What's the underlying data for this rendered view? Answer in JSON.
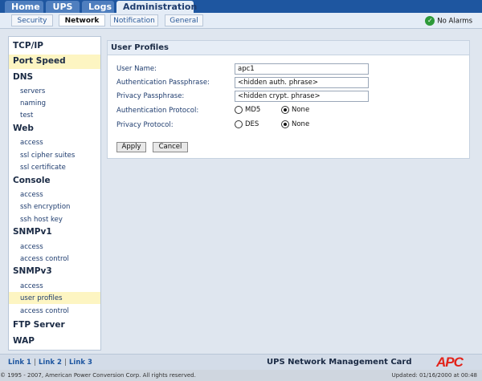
{
  "top_tabs": [
    "Home",
    "UPS",
    "Logs",
    "Administration"
  ],
  "sub_tabs": [
    "Security",
    "Network",
    "Notification",
    "General"
  ],
  "alarm_status": "No Alarms",
  "sidebar": {
    "items": [
      {
        "label": "TCP/IP",
        "kind": "head"
      },
      {
        "label": "Port Speed",
        "kind": "head"
      },
      {
        "label": "DNS",
        "kind": "head"
      },
      {
        "label": "servers",
        "kind": "sub"
      },
      {
        "label": "naming",
        "kind": "sub"
      },
      {
        "label": "test",
        "kind": "sub"
      },
      {
        "label": "Web",
        "kind": "head"
      },
      {
        "label": "access",
        "kind": "sub"
      },
      {
        "label": "ssl cipher suites",
        "kind": "sub"
      },
      {
        "label": "ssl certificate",
        "kind": "sub"
      },
      {
        "label": "Console",
        "kind": "head"
      },
      {
        "label": "access",
        "kind": "sub"
      },
      {
        "label": "ssh encryption",
        "kind": "sub"
      },
      {
        "label": "ssh host key",
        "kind": "sub"
      },
      {
        "label": "SNMPv1",
        "kind": "head"
      },
      {
        "label": "access",
        "kind": "sub"
      },
      {
        "label": "access control",
        "kind": "sub"
      },
      {
        "label": "SNMPv3",
        "kind": "head"
      },
      {
        "label": "access",
        "kind": "sub"
      },
      {
        "label": "user profiles",
        "kind": "sub"
      },
      {
        "label": "access control",
        "kind": "sub"
      },
      {
        "label": "FTP Server",
        "kind": "head"
      },
      {
        "label": "WAP",
        "kind": "head"
      }
    ]
  },
  "panel": {
    "title": "User Profiles",
    "user_name_label": "User Name:",
    "user_name_value": "apc1",
    "auth_pass_label": "Authentication Passphrase:",
    "auth_pass_value": "<hidden auth. phrase>",
    "priv_pass_label": "Privacy Passphrase:",
    "priv_pass_value": "<hidden crypt. phrase>",
    "auth_proto_label": "Authentication Protocol:",
    "auth_proto_opt1": "MD5",
    "auth_proto_opt2": "None",
    "priv_proto_label": "Privacy Protocol:",
    "priv_proto_opt1": "DES",
    "priv_proto_opt2": "None",
    "apply_label": "Apply",
    "cancel_label": "Cancel"
  },
  "footer": {
    "link1": "Link 1",
    "link2": "Link 2",
    "link3": "Link 3",
    "sep": "|",
    "product": "UPS Network Management Card",
    "brand": "APC",
    "copyright": "© 1995 - 2007, American Power Conversion Corp. All rights reserved.",
    "updated": "Updated: 01/16/2000 at 00:48"
  },
  "colors": {
    "header_blue": "#1e56a0",
    "highlight": "#fdf5c2",
    "brand_red": "#e2231a",
    "status_green": "#2e9a3a"
  }
}
